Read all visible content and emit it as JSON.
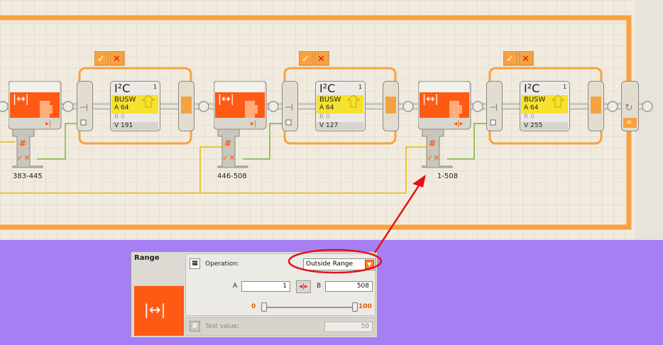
{
  "program": {
    "loop_label": "∞",
    "groups": [
      {
        "range_label": "383-445",
        "i2c": {
          "title": "I²C",
          "port": "1",
          "bus": "BUSW",
          "addr": "A 64",
          "mode": "R 0",
          "value": "V 191"
        }
      },
      {
        "range_label": "446-508",
        "i2c": {
          "title": "I²C",
          "port": "1",
          "bus": "BUSW",
          "addr": "A 64",
          "mode": "R 0",
          "value": "V 127"
        }
      },
      {
        "range_label": "1-508",
        "i2c": {
          "title": "I²C",
          "port": "1",
          "bus": "BUSW",
          "addr": "A 64",
          "mode": "R 0",
          "value": "V 255"
        }
      }
    ]
  },
  "dialog": {
    "title": "Range",
    "operation_label": "Operation:",
    "operation_value": "Outside Range",
    "a_label": "A",
    "a_value": "1",
    "b_label": "B",
    "b_value": "508",
    "slider_min": "0",
    "slider_max": "100",
    "test_value_label": "Test value:",
    "test_value": "50"
  },
  "colors": {
    "block_orange": "#ff5a13",
    "i2c_yellow": "#f6e12f",
    "wire_orange": "#f7a23f",
    "wire_green": "#7bb33a",
    "wire_yellow": "#e4be00",
    "annotation_red": "#e3111a",
    "panel_purple": "#a77ff5"
  }
}
